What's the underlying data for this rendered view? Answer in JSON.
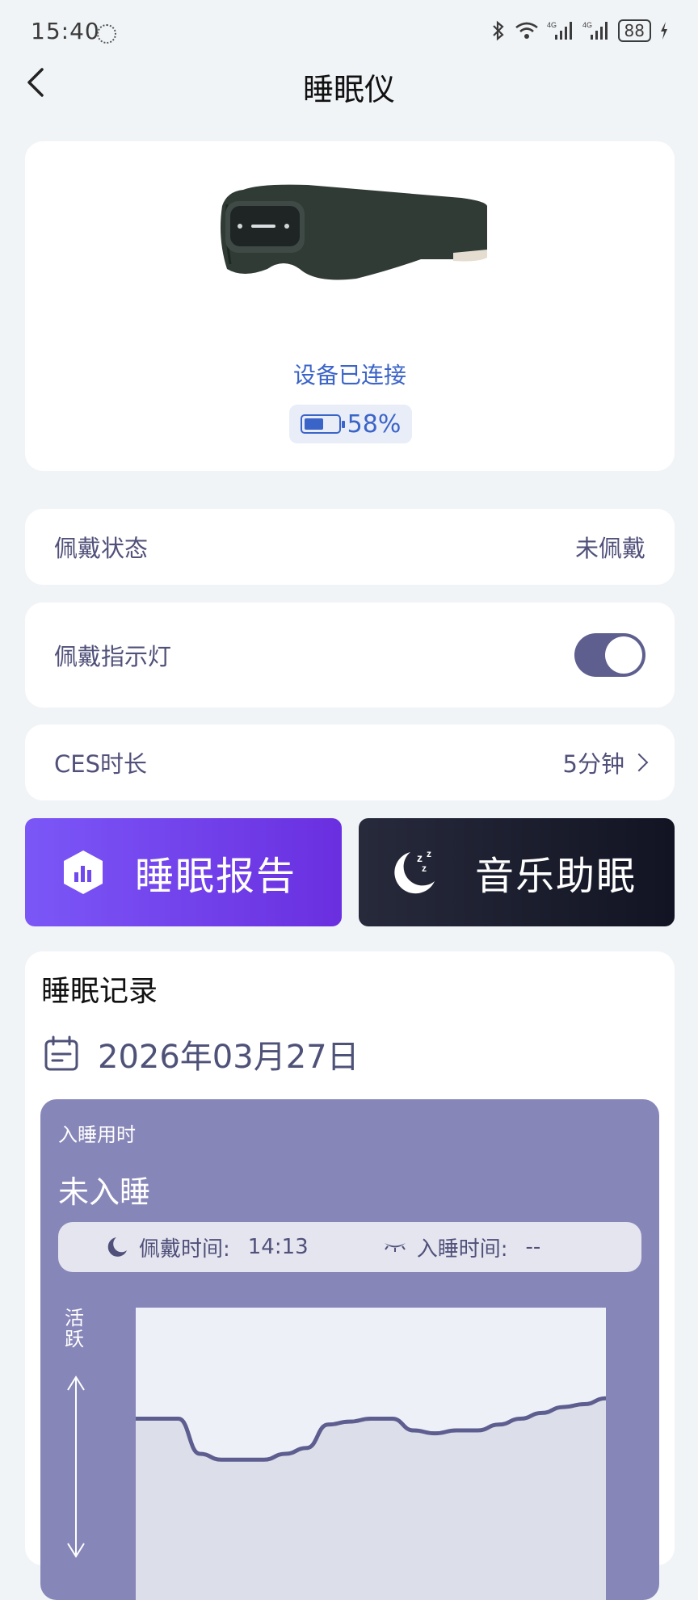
{
  "status_bar": {
    "time": "15:40",
    "battery": "88",
    "icons": [
      "bluetooth-icon",
      "wifi-icon",
      "signal-4g-icon",
      "signal-4g-icon",
      "battery-icon",
      "charging-icon"
    ]
  },
  "header": {
    "title": "睡眠仪"
  },
  "device": {
    "status_text": "设备已连接",
    "battery_level": 0.58,
    "battery_text": "58%"
  },
  "settings": {
    "wear_status": {
      "label": "佩戴状态",
      "value": "未佩戴"
    },
    "wear_light": {
      "label": "佩戴指示灯",
      "enabled": true
    },
    "ces_duration": {
      "label": "CES时长",
      "value": "5分钟"
    }
  },
  "actions": {
    "report_label": "睡眠报告",
    "music_label": "音乐助眠"
  },
  "record": {
    "title": "睡眠记录",
    "date": "2026年03月27日",
    "sleep_latency_label": "入睡用时",
    "sleep_latency_value": "未入睡",
    "wear_time_label": "佩戴时间:",
    "wear_time_value": "14:13",
    "sleep_time_label": "入睡时间:",
    "sleep_time_value": "--",
    "axis_label": "活跃"
  },
  "colors": {
    "accent": "#3b64c9",
    "toggle": "#5e5f8e",
    "report_gradient": [
      "#7b57f7",
      "#6a2fe0"
    ],
    "music_gradient": [
      "#272a3b",
      "#121423"
    ],
    "panel": "#8786b9"
  },
  "chart_data": {
    "type": "area",
    "title": "",
    "xlabel": "",
    "ylabel": "活跃",
    "values": [
      0.62,
      0.62,
      0.62,
      0.5,
      0.48,
      0.48,
      0.48,
      0.5,
      0.52,
      0.6,
      0.61,
      0.62,
      0.62,
      0.58,
      0.57,
      0.58,
      0.58,
      0.6,
      0.62,
      0.64,
      0.66,
      0.67,
      0.69
    ],
    "ylim": [
      0,
      1
    ],
    "grid": false
  }
}
